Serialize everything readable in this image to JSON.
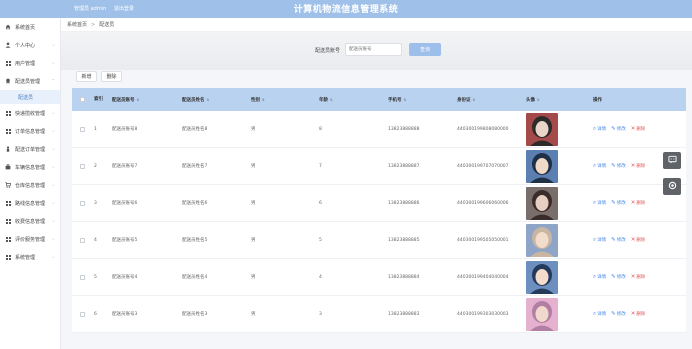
{
  "header": {
    "user_label": "管理员 admin",
    "logout_label": "退出登录",
    "title": "计算机物流信息管理系统"
  },
  "sidebar": {
    "items": [
      {
        "label": "系统首页",
        "icon": "home-icon",
        "chevron": false
      },
      {
        "label": "个人中心",
        "icon": "user-icon",
        "chevron": true
      },
      {
        "label": "用户管理",
        "icon": "grid-icon",
        "chevron": true
      },
      {
        "label": "配送员管理",
        "icon": "medal-icon",
        "chevron": true,
        "expanded": true,
        "sub": [
          {
            "label": "配送员",
            "active": true
          }
        ]
      },
      {
        "label": "快递揽收管理",
        "icon": "grid-icon",
        "chevron": true
      },
      {
        "label": "订单信息管理",
        "icon": "grid-icon",
        "chevron": true
      },
      {
        "label": "配送订单管理",
        "icon": "person-icon",
        "chevron": true
      },
      {
        "label": "车辆信息管理",
        "icon": "bag-icon",
        "chevron": true
      },
      {
        "label": "仓库信息管理",
        "icon": "cart-icon",
        "chevron": true
      },
      {
        "label": "路线信息管理",
        "icon": "grid-icon",
        "chevron": true
      },
      {
        "label": "收费信息管理",
        "icon": "grid-icon",
        "chevron": true
      },
      {
        "label": "评价服务管理",
        "icon": "grid-icon",
        "chevron": true
      },
      {
        "label": "系统管理",
        "icon": "grid-icon",
        "chevron": true
      }
    ]
  },
  "breadcrumb": {
    "home": "系统首页",
    "separator": ">",
    "current": "配送员"
  },
  "search": {
    "label": "配送员账号",
    "placeholder": "配送员账号",
    "button_label": "查询"
  },
  "toolbar": {
    "add_label": "新增",
    "delete_label": "删除"
  },
  "table": {
    "columns": [
      "索引",
      "配送员账号",
      "配送员姓名",
      "性别",
      "年龄",
      "手机号",
      "身份证",
      "头像",
      "操作"
    ],
    "rows": [
      {
        "index": "1",
        "account": "配送员账号8",
        "name": "配送员姓名8",
        "gender": "男",
        "age": "8",
        "phone": "13823888888",
        "id_card": "440300199808080000"
      },
      {
        "index": "2",
        "account": "配送员账号7",
        "name": "配送员姓名7",
        "gender": "男",
        "age": "7",
        "phone": "13823888887",
        "id_card": "440300199707070007"
      },
      {
        "index": "3",
        "account": "配送员账号6",
        "name": "配送员姓名6",
        "gender": "男",
        "age": "6",
        "phone": "13823888886",
        "id_card": "440300199606060006"
      },
      {
        "index": "4",
        "account": "配送员账号5",
        "name": "配送员姓名5",
        "gender": "男",
        "age": "5",
        "phone": "13823888885",
        "id_card": "440300199505050001"
      },
      {
        "index": "5",
        "account": "配送员账号4",
        "name": "配送员姓名4",
        "gender": "男",
        "age": "4",
        "phone": "13823888884",
        "id_card": "440300199404040004"
      },
      {
        "index": "6",
        "account": "配送员账号3",
        "name": "配送员姓名3",
        "gender": "男",
        "age": "3",
        "phone": "13823888883",
        "id_card": "440300199303030003"
      }
    ],
    "actions": {
      "detail": "详情",
      "edit": "修改",
      "delete": "删除"
    }
  },
  "colors": {
    "header_bg": "#9fc0e8",
    "table_header_bg": "#b9d2f0",
    "link_blue": "#4a8ae6",
    "danger_red": "#e05a5a",
    "active_sub_bg": "#e8f0fb"
  }
}
